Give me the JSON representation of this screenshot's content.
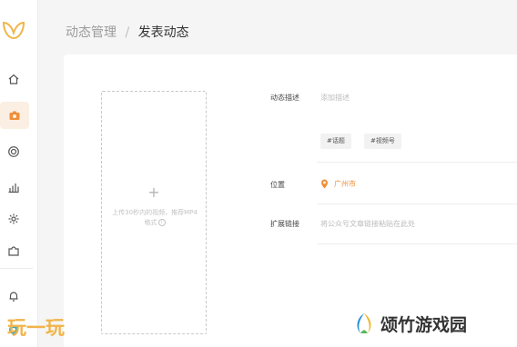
{
  "breadcrumb": {
    "parent": "动态管理",
    "separator": "/",
    "current": "发表动态"
  },
  "upload": {
    "plus": "+",
    "hint": "上传30秒内的视频，推荐MP4格式",
    "info": "i"
  },
  "form": {
    "description": {
      "label": "动态描述",
      "placeholder": "添加描述"
    },
    "tags": [
      "#话题",
      "#视频号"
    ],
    "location": {
      "label": "位置",
      "value": "广州市"
    },
    "extended_link": {
      "label": "扩展链接",
      "placeholder": "将公众号文章链接粘贴在此处"
    }
  },
  "sidebar": {
    "items": [
      {
        "icon": "home-icon"
      },
      {
        "icon": "camera-icon",
        "active": true
      },
      {
        "icon": "target-icon"
      },
      {
        "icon": "bar-chart-icon"
      },
      {
        "icon": "gear-icon"
      },
      {
        "icon": "puzzle-icon"
      },
      {
        "icon": "bell-icon"
      },
      {
        "icon": "circle-icon"
      }
    ]
  },
  "watermarks": {
    "left": "玩一玩",
    "right": "颂竹游戏园"
  },
  "colors": {
    "accent": "#f0903a",
    "active_bg": "#fbefe3",
    "background": "#f5f5f5"
  }
}
